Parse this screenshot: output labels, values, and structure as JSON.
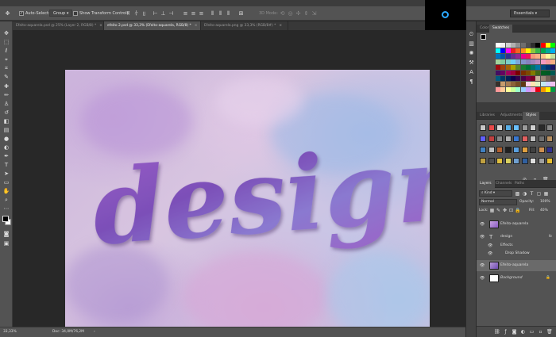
{
  "options_bar": {
    "auto_select_label": "Auto-Select:",
    "auto_select_value": "Group",
    "transform_label": "Show Transform Controls",
    "mode_label": "3D Mode:"
  },
  "workspace": {
    "label": "Essentials"
  },
  "tabs": [
    {
      "label": "Efeito-aquarela.psd @ 25% (Layer 2, RGB/8) *",
      "close": "×"
    },
    {
      "label": "efeito 2.psd @ 33,3% (Efeito-aquarela, RGB/8) *",
      "close": "×"
    },
    {
      "label": "Efeito-aquarela.png @ 33,3% (RGB/8#) *",
      "close": "×"
    }
  ],
  "canvas": {
    "word": "design"
  },
  "status": {
    "zoom": "33,33%",
    "doc": "Doc: 34,0M/76,2M",
    "arrow": "›"
  },
  "color_panel": {
    "tabs": [
      "Color",
      "Swatches"
    ],
    "swatch_colors": [
      [
        "#ffffff",
        "#f0f0f0",
        "#d0d0d0",
        "#b0b0b0",
        "#8e8e8e",
        "#6e6e6e",
        "#4e4e4e",
        "#2e2e2e",
        "#000000",
        "#ff0000",
        "#ffff00",
        "#00ff00"
      ],
      [
        "#00ffff",
        "#0000ff",
        "#ff00ff",
        "#ed1c24",
        "#f26522",
        "#f7941d",
        "#fff200",
        "#8dc63f",
        "#39b54a",
        "#00a651",
        "#00a99d",
        "#00aeef"
      ],
      [
        "#0072bc",
        "#0054a6",
        "#2e3192",
        "#662d91",
        "#92278f",
        "#ec008c",
        "#ed145b",
        "#f7977a",
        "#fbad82",
        "#fdc68a",
        "#fff79a",
        "#c4df9b"
      ],
      [
        "#a2d39c",
        "#82ca9d",
        "#7bcdc8",
        "#6dcff6",
        "#7da7d9",
        "#8393ca",
        "#8781bd",
        "#a187be",
        "#bd8cbf",
        "#f49ac1",
        "#f5989d",
        "#f9ad81"
      ],
      [
        "#9e0b0f",
        "#a0410d",
        "#a36209",
        "#aba000",
        "#598527",
        "#1a7b30",
        "#007236",
        "#00746b",
        "#0076a3",
        "#004a80",
        "#003471",
        "#1b1464"
      ],
      [
        "#440e62",
        "#630460",
        "#9e005d",
        "#9e0039",
        "#790000",
        "#7b2e00",
        "#7d4900",
        "#827b00",
        "#406618",
        "#005e20",
        "#005826",
        "#005952"
      ],
      [
        "#005b7f",
        "#003663",
        "#002157",
        "#0d004c",
        "#32004b",
        "#4b0049",
        "#7b0046",
        "#7a0026",
        "#c7b299",
        "#998675",
        "#736357",
        "#534741"
      ],
      [
        "#37302a",
        "#c69c6d",
        "#a67c52",
        "#8c6239",
        "#754c24",
        "#603913",
        "#ffd0e8",
        "#ffe4b0",
        "#e0f0c0",
        "#c0e8f0",
        "#d0d0ff",
        "#f0c0f0"
      ],
      [
        "#ff9999",
        "#ffcc99",
        "#ffff99",
        "#ccff99",
        "#99ffcc",
        "#99ccff",
        "#cc99ff",
        "#ff99cc",
        "#e60012",
        "#f39800",
        "#fff100",
        "#009944"
      ]
    ]
  },
  "styles_panel": {
    "tabs": [
      "Libraries",
      "Adjustments",
      "Styles"
    ],
    "style_colors": [
      [
        "#c8c8c8",
        "#e84a4a",
        "#d8d8d8",
        "#5ab0e8",
        "#6ac0ff",
        "#9a9a9a",
        "#d0d0d0",
        "#2a2a2a",
        "#888888"
      ],
      [
        "#6060ff",
        "#c04040",
        "#888888",
        "#b0b0b0",
        "#3a78d0",
        "#e06060",
        "#c0c0c0",
        "#707070",
        "#b89060"
      ],
      [
        "#4080c0",
        "#c0c0c0",
        "#b06030",
        "#202020",
        "#5aa0e0",
        "#e0a040",
        "#404040",
        "#d09050",
        "#303090"
      ],
      [
        "#c0a040",
        "#505050",
        "#e0c040",
        "#d8d060",
        "#70a0d0",
        "#3060a0",
        "#e0e0e0",
        "#a0a0a0",
        "#e8c030"
      ]
    ]
  },
  "layers_panel": {
    "tabs": [
      "Layers",
      "Channels",
      "Paths"
    ],
    "kind_label": "Kind",
    "blend_mode": "Normal",
    "opacity_label": "Opacity:",
    "opacity_value": "100%",
    "lock_label": "Lock:",
    "fill_label": "Fill:",
    "fill_value": "40%",
    "layers": [
      {
        "name": "Efeito-aquarela",
        "type": "image"
      },
      {
        "name": "design",
        "type": "text",
        "fx": "fx"
      },
      {
        "name": "Effects",
        "type": "effects"
      },
      {
        "name": "Drop Shadow",
        "type": "effect"
      },
      {
        "name": "Efeito-aquarela",
        "type": "image",
        "selected": true
      },
      {
        "name": "Background",
        "type": "background"
      }
    ]
  },
  "colors": {
    "panel_bg": "#535353",
    "dark_bg": "#282828",
    "accent": "#2aa8ff",
    "text_purple": "#8a54c0"
  }
}
